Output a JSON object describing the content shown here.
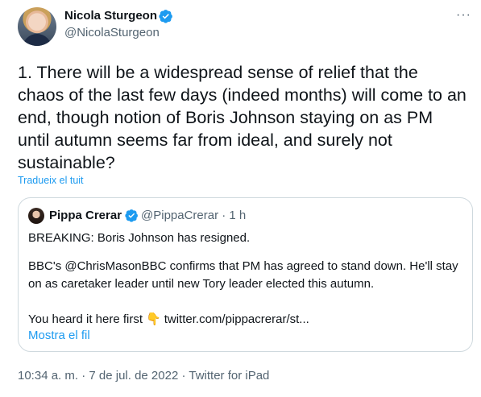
{
  "author": {
    "name": "Nicola Sturgeon",
    "handle": "@NicolaSturgeon"
  },
  "more_label": "···",
  "tweet_text": "1. There will be a widespread sense of relief that the chaos of the last few days (indeed months) will come to an end, though notion of Boris Johnson staying on as PM until autumn seems far from ideal, and surely not sustainable?",
  "translate_link": "Tradueix el tuit",
  "quoted": {
    "name": "Pippa Crerar",
    "handle_time": "@PippaCrerar · 1 h",
    "line1": "BREAKING: Boris Johnson has resigned.",
    "line2": "BBC's @ChrisMasonBBC confirms that PM has agreed to stand down. He'll stay",
    "line3": "on as caretaker leader until new Tory leader elected this autumn.",
    "line4_pre": "You heard it here first",
    "line4_emoji": "👇",
    "line4_link": "twitter.com/pippacrerar/st...",
    "show_thread": "Mostra el fil"
  },
  "meta": "10:34 a. m. · 7 de jul. de 2022 · Twitter for iPad",
  "colors": {
    "verified": "#1d9bf0",
    "link": "#1d9bf0",
    "secondary": "#536471"
  },
  "icons": [
    "verified-badge-icon",
    "more-options-icon",
    "backhand-index-pointing-down-icon"
  ]
}
